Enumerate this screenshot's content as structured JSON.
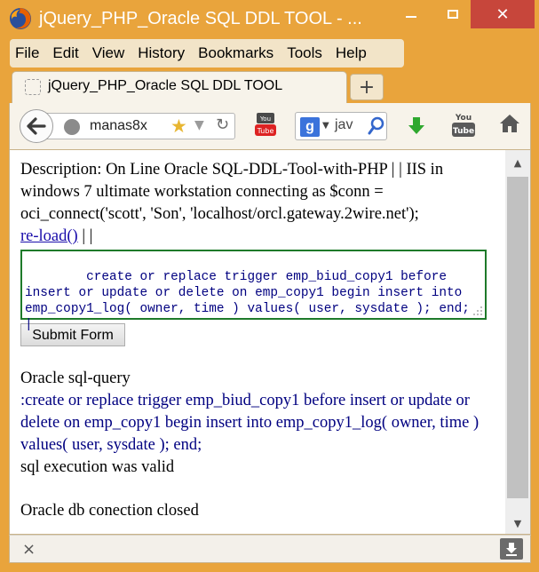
{
  "window": {
    "title": "jQuery_PHP_Oracle SQL DDL TOOL - ...",
    "minimize_label": "",
    "maximize_label": "",
    "close_label": "✕"
  },
  "menu": [
    "File",
    "Edit",
    "View",
    "History",
    "Bookmarks",
    "Tools",
    "Help"
  ],
  "tab": {
    "label": "jQuery_PHP_Oracle SQL DDL TOOL",
    "new_tab_label": "+"
  },
  "nav": {
    "url": "manas8x",
    "search_engine_letter": "g",
    "search_text": "jav"
  },
  "page": {
    "description": "Description: On Line Oracle SQL-DDL-Tool-with-PHP | | IIS in windows 7 ultimate workstation connecting as $conn = oci_connect('scott', 'Son', 'localhost/orcl.gateway.2wire.net');",
    "reload_link": "re-load()",
    "reload_suffix": "| |",
    "sql_input": "create or replace trigger emp_biud_copy1 before insert or update or delete on emp_copy1 begin insert into emp_copy1_log( owner, time ) values( user, sysdate ); end; |",
    "submit_label": "Submit Form",
    "query_heading": "Oracle sql-query",
    "query_echo": ":create or replace trigger emp_biud_copy1 before insert or update or delete on emp_copy1 begin insert into emp_copy1_log( owner, time ) values( user, sysdate ); end;",
    "exec_status": "sql execution was valid",
    "close_status": "Oracle db conection closed"
  },
  "statusbar": {
    "close_label": "×"
  },
  "colors": {
    "frame": "#e9a43c",
    "close_button": "#c7463b",
    "sql_text": "#000080",
    "sql_border": "#1e7a2a",
    "link": "#1a0dab"
  },
  "icons": [
    "firefox-logo",
    "back-arrow-icon",
    "globe-icon",
    "star-icon",
    "reload-icon",
    "youtube-icon",
    "google-icon",
    "search-icon",
    "download-icon",
    "home-icon",
    "close-icon",
    "downloads-button-icon"
  ]
}
